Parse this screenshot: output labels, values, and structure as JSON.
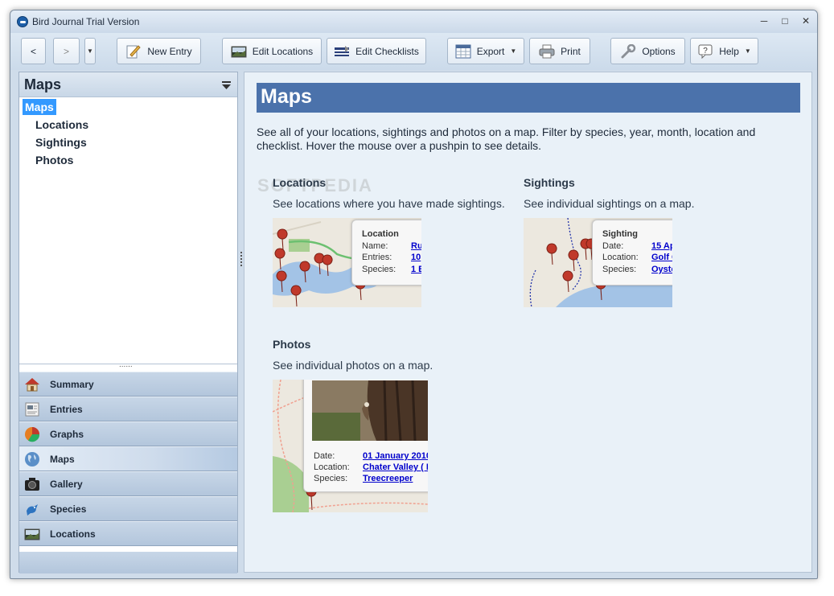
{
  "window": {
    "title": "Bird Journal Trial Version"
  },
  "toolbar": {
    "back": "<",
    "forward": ">",
    "new_entry": "New Entry",
    "edit_locations": "Edit Locations",
    "edit_checklists": "Edit Checklists",
    "export": "Export",
    "print": "Print",
    "options": "Options",
    "help": "Help"
  },
  "sidebar": {
    "title": "Maps",
    "tree": [
      "Maps",
      "Locations",
      "Sightings",
      "Photos"
    ],
    "nav": [
      "Summary",
      "Entries",
      "Graphs",
      "Maps",
      "Gallery",
      "Species",
      "Locations"
    ],
    "active_nav": "Maps"
  },
  "content": {
    "title": "Maps",
    "description": "See all of your locations, sightings and photos on a map. Filter by species, year, month, location and checklist. Hover the mouse over a pushpin to see details.",
    "watermark": "SOFTPEDIA",
    "sections": {
      "locations": {
        "title": "Locations",
        "description": "See locations where you have made sightings.",
        "popup": {
          "heading": "Location",
          "labels": [
            "Name:",
            "Entries:",
            "Species:"
          ],
          "values": [
            "Ru",
            "10",
            "1 E"
          ]
        }
      },
      "sightings": {
        "title": "Sightings",
        "description": "See individual sightings on a map.",
        "popup": {
          "heading": "Sighting",
          "labels": [
            "Date:",
            "Location:",
            "Species:"
          ],
          "values": [
            "15 Ap",
            "Golf C",
            "Oyste"
          ]
        }
      },
      "photos": {
        "title": "Photos",
        "description": "See individual photos on a map.",
        "popup": {
          "labels": [
            "Date:",
            "Location:",
            "Species:"
          ],
          "values": [
            "01 January 2010",
            "Chater Valley ( L",
            "Treecreeper"
          ]
        }
      }
    }
  },
  "colors": {
    "accent": "#4b72ab",
    "selection": "#3399ff",
    "link": "#0000cc",
    "pin": "#c0392b"
  }
}
